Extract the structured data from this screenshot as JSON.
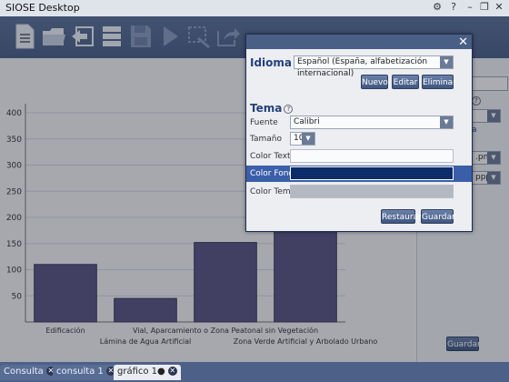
{
  "window": {
    "title": "SIOSE Desktop"
  },
  "titlebar_buttons": [
    "gear-icon",
    "help-icon",
    "minimize-icon",
    "maximize-icon",
    "close-icon"
  ],
  "toolbar": {
    "tools": [
      "new-document-icon",
      "open-folder-icon",
      "back-icon",
      "server-icon",
      "save-icon",
      "play-icon",
      "edit-area-icon",
      "export-icon"
    ]
  },
  "chart_data": {
    "type": "bar",
    "categories": [
      "Edificación",
      "Lámina de Agua Artificial",
      "Vial, Aparcamiento o Zona Peatonal sin Vegetación",
      "Zona Verde Artificial y Arbolado Urbano"
    ],
    "values": [
      110,
      45,
      152,
      190
    ],
    "ylim": [
      0,
      400
    ],
    "yticks": [
      50,
      100,
      150,
      200,
      250,
      300,
      350,
      400
    ],
    "grid": true,
    "bar_color": "#5b5582"
  },
  "dialog": {
    "idioma_title": "Idioma",
    "idioma_value": "Español (España, alfabetización internacional)",
    "btn_nuevo": "Nuevo",
    "btn_editar": "Editar",
    "btn_eliminar": "Eliminar",
    "tema_title": "Tema",
    "fuente_label": "Fuente",
    "fuente_value": "Calibri",
    "tamano_label": "Tamaño",
    "tamano_value": "10",
    "color_texto_label": "Color Texto",
    "color_fondo_label": "Color Fondo",
    "color_tema_label": "Color Tema",
    "btn_restaurar": "Restaurar",
    "btn_guardar": "Guardar"
  },
  "rightpanel": {
    "ext_value": ".png)",
    "res_value": "ppp",
    "partial_label": "a",
    "btn_guardar": "Guardar"
  },
  "tabs": [
    {
      "label": "Consulta",
      "active": false
    },
    {
      "label": "consulta 1",
      "active": false
    },
    {
      "label": "gráfico 1●",
      "active": true
    }
  ]
}
